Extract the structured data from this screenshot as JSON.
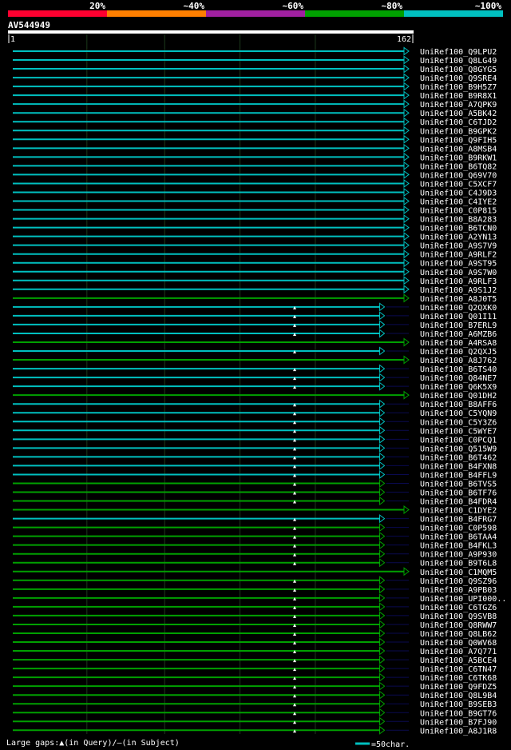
{
  "chart_data": {
    "type": "alignment",
    "query_id": "AV544949",
    "query_start": "1",
    "query_end": "162",
    "identity_scale": {
      "labels": [
        "20%",
        "~40%",
        "~60%",
        "~80%",
        "~100%"
      ],
      "colors": [
        "#ff0030",
        "#ff7f00",
        "#a020a0",
        "#00a000",
        "#00c0c0"
      ]
    },
    "x_range": [
      1,
      162
    ],
    "hits": [
      {
        "id": "UniRef100_Q9LPU2",
        "end": 162,
        "color": "#00c0c0",
        "gap": false
      },
      {
        "id": "UniRef100_Q8LG49",
        "end": 162,
        "color": "#00c0c0",
        "gap": false
      },
      {
        "id": "UniRef100_Q8GYG5",
        "end": 162,
        "color": "#00c0c0",
        "gap": false
      },
      {
        "id": "UniRef100_Q9SRE4",
        "end": 162,
        "color": "#00c0c0",
        "gap": false
      },
      {
        "id": "UniRef100_B9H5Z7",
        "end": 162,
        "color": "#00c0c0",
        "gap": false
      },
      {
        "id": "UniRef100_B9R8X1",
        "end": 162,
        "color": "#00c0c0",
        "gap": false
      },
      {
        "id": "UniRef100_A7QPK9",
        "end": 162,
        "color": "#00c0c0",
        "gap": false
      },
      {
        "id": "UniRef100_A5BK42",
        "end": 162,
        "color": "#00c0c0",
        "gap": false
      },
      {
        "id": "UniRef100_C6TJD2",
        "end": 162,
        "color": "#00c0c0",
        "gap": false
      },
      {
        "id": "UniRef100_B9GPK2",
        "end": 162,
        "color": "#00c0c0",
        "gap": false
      },
      {
        "id": "UniRef100_Q9FIH5",
        "end": 162,
        "color": "#00c0c0",
        "gap": false
      },
      {
        "id": "UniRef100_A8MSB4",
        "end": 162,
        "color": "#00c0c0",
        "gap": false
      },
      {
        "id": "UniRef100_B9RKW1",
        "end": 162,
        "color": "#00c0c0",
        "gap": false
      },
      {
        "id": "UniRef100_B6TQ82",
        "end": 162,
        "color": "#00c0c0",
        "gap": false
      },
      {
        "id": "UniRef100_Q69V70",
        "end": 162,
        "color": "#00c0c0",
        "gap": false
      },
      {
        "id": "UniRef100_C5XCF7",
        "end": 162,
        "color": "#00c0c0",
        "gap": false
      },
      {
        "id": "UniRef100_C4J9D3",
        "end": 162,
        "color": "#00c0c0",
        "gap": false
      },
      {
        "id": "UniRef100_C4IYE2",
        "end": 162,
        "color": "#00c0c0",
        "gap": false
      },
      {
        "id": "UniRef100_C0P815",
        "end": 162,
        "color": "#00c0c0",
        "gap": false
      },
      {
        "id": "UniRef100_B8A283",
        "end": 162,
        "color": "#00c0c0",
        "gap": false
      },
      {
        "id": "UniRef100_B6TCN0",
        "end": 162,
        "color": "#00c0c0",
        "gap": false
      },
      {
        "id": "UniRef100_A2YN13",
        "end": 162,
        "color": "#00c0c0",
        "gap": false
      },
      {
        "id": "UniRef100_A9S7V9",
        "end": 162,
        "color": "#00c0c0",
        "gap": false
      },
      {
        "id": "UniRef100_A9RLF2",
        "end": 162,
        "color": "#00c0c0",
        "gap": false
      },
      {
        "id": "UniRef100_A9ST95",
        "end": 162,
        "color": "#00c0c0",
        "gap": false
      },
      {
        "id": "UniRef100_A9S7W0",
        "end": 162,
        "color": "#00c0c0",
        "gap": false
      },
      {
        "id": "UniRef100_A9RLF3",
        "end": 162,
        "color": "#00c0c0",
        "gap": false
      },
      {
        "id": "UniRef100_A9S1J2",
        "end": 162,
        "color": "#00c0c0",
        "gap": false
      },
      {
        "id": "UniRef100_A8J0T5",
        "end": 162,
        "color": "#00a000",
        "gap": false
      },
      {
        "id": "UniRef100_Q2QXK0",
        "end": 152,
        "color": "#00c0c0",
        "gap": true
      },
      {
        "id": "UniRef100_Q01I11",
        "end": 152,
        "color": "#00c0c0",
        "gap": true
      },
      {
        "id": "UniRef100_B7ERL9",
        "end": 152,
        "color": "#00c0c0",
        "gap": true
      },
      {
        "id": "UniRef100_A6MZB6",
        "end": 152,
        "color": "#00c0c0",
        "gap": true
      },
      {
        "id": "UniRef100_A4RSA8",
        "end": 162,
        "color": "#00a000",
        "gap": false
      },
      {
        "id": "UniRef100_Q2QXJ5",
        "end": 152,
        "color": "#00c0c0",
        "gap": true
      },
      {
        "id": "UniRef100_A8J762",
        "end": 162,
        "color": "#00a000",
        "gap": false
      },
      {
        "id": "UniRef100_B6TS40",
        "end": 152,
        "color": "#00c0c0",
        "gap": true
      },
      {
        "id": "UniRef100_Q84NE7",
        "end": 152,
        "color": "#00c0c0",
        "gap": true
      },
      {
        "id": "UniRef100_Q6K5X9",
        "end": 152,
        "color": "#00c0c0",
        "gap": true
      },
      {
        "id": "UniRef100_Q01DH2",
        "end": 162,
        "color": "#00a000",
        "gap": false
      },
      {
        "id": "UniRef100_B8AFF6",
        "end": 152,
        "color": "#00c0c0",
        "gap": true
      },
      {
        "id": "UniRef100_C5YQN9",
        "end": 152,
        "color": "#00c0c0",
        "gap": true
      },
      {
        "id": "UniRef100_C5Y3Z6",
        "end": 152,
        "color": "#00c0c0",
        "gap": true
      },
      {
        "id": "UniRef100_C5WYE7",
        "end": 152,
        "color": "#00c0c0",
        "gap": true
      },
      {
        "id": "UniRef100_C0PCQ1",
        "end": 152,
        "color": "#00c0c0",
        "gap": true
      },
      {
        "id": "UniRef100_Q515W9",
        "end": 152,
        "color": "#00c0c0",
        "gap": true
      },
      {
        "id": "UniRef100_B6T462",
        "end": 152,
        "color": "#00c0c0",
        "gap": true
      },
      {
        "id": "UniRef100_B4FXN8",
        "end": 152,
        "color": "#00c0c0",
        "gap": true
      },
      {
        "id": "UniRef100_B4FFL9",
        "end": 152,
        "color": "#00c0c0",
        "gap": true
      },
      {
        "id": "UniRef100_B6TVS5",
        "end": 152,
        "color": "#00a000",
        "gap": true
      },
      {
        "id": "UniRef100_B6TF76",
        "end": 152,
        "color": "#00a000",
        "gap": true
      },
      {
        "id": "UniRef100_B4FDR4",
        "end": 152,
        "color": "#00a000",
        "gap": true
      },
      {
        "id": "UniRef100_C1DYE2",
        "end": 162,
        "color": "#00a000",
        "gap": false
      },
      {
        "id": "UniRef100_B4FRG7",
        "end": 152,
        "color": "#00c0c0",
        "gap": true
      },
      {
        "id": "UniRef100_C0P598",
        "end": 152,
        "color": "#00a000",
        "gap": true
      },
      {
        "id": "UniRef100_B6TAA4",
        "end": 152,
        "color": "#00a000",
        "gap": true
      },
      {
        "id": "UniRef100_B4FKL3",
        "end": 152,
        "color": "#00a000",
        "gap": true
      },
      {
        "id": "UniRef100_A9P930",
        "end": 152,
        "color": "#00a000",
        "gap": true
      },
      {
        "id": "UniRef100_B9T6L8",
        "end": 152,
        "color": "#00a000",
        "gap": true
      },
      {
        "id": "UniRef100_C1MQM5",
        "end": 162,
        "color": "#00a000",
        "gap": false
      },
      {
        "id": "UniRef100_Q9SZ96",
        "end": 152,
        "color": "#00a000",
        "gap": true
      },
      {
        "id": "UniRef100_A9PB03",
        "end": 152,
        "color": "#00a000",
        "gap": true
      },
      {
        "id": "UniRef100_UPI000..",
        "end": 152,
        "color": "#00a000",
        "gap": true
      },
      {
        "id": "UniRef100_C6TGZ6",
        "end": 152,
        "color": "#00a000",
        "gap": true
      },
      {
        "id": "UniRef100_Q9SVB8",
        "end": 152,
        "color": "#00a000",
        "gap": true
      },
      {
        "id": "UniRef100_Q8RWW7",
        "end": 152,
        "color": "#00a000",
        "gap": true
      },
      {
        "id": "UniRef100_Q8LB62",
        "end": 152,
        "color": "#00a000",
        "gap": true
      },
      {
        "id": "UniRef100_Q0WV68",
        "end": 152,
        "color": "#00a000",
        "gap": true
      },
      {
        "id": "UniRef100_A7Q771",
        "end": 152,
        "color": "#00a000",
        "gap": true
      },
      {
        "id": "UniRef100_A5BCE4",
        "end": 152,
        "color": "#00a000",
        "gap": true
      },
      {
        "id": "UniRef100_C6TN47",
        "end": 152,
        "color": "#00a000",
        "gap": true
      },
      {
        "id": "UniRef100_C6TK68",
        "end": 152,
        "color": "#00a000",
        "gap": true
      },
      {
        "id": "UniRef100_Q9FDZ5",
        "end": 152,
        "color": "#00a000",
        "gap": true
      },
      {
        "id": "UniRef100_Q8L9B4",
        "end": 152,
        "color": "#00a000",
        "gap": true
      },
      {
        "id": "UniRef100_B9SEB3",
        "end": 152,
        "color": "#00a000",
        "gap": true
      },
      {
        "id": "UniRef100_B9GT76",
        "end": 152,
        "color": "#00a000",
        "gap": true
      },
      {
        "id": "UniRef100_B7FJ90",
        "end": 152,
        "color": "#00a000",
        "gap": true
      },
      {
        "id": "UniRef100_A8J1R8",
        "end": 152,
        "color": "#00a000",
        "gap": true
      }
    ],
    "gap_position": 117
  },
  "footer": {
    "gaps_text": "Large gaps:",
    "query_text": "(in Query)/",
    "dash": "—",
    "subject_text": "(in Subject)",
    "scale_text": "=50char."
  }
}
